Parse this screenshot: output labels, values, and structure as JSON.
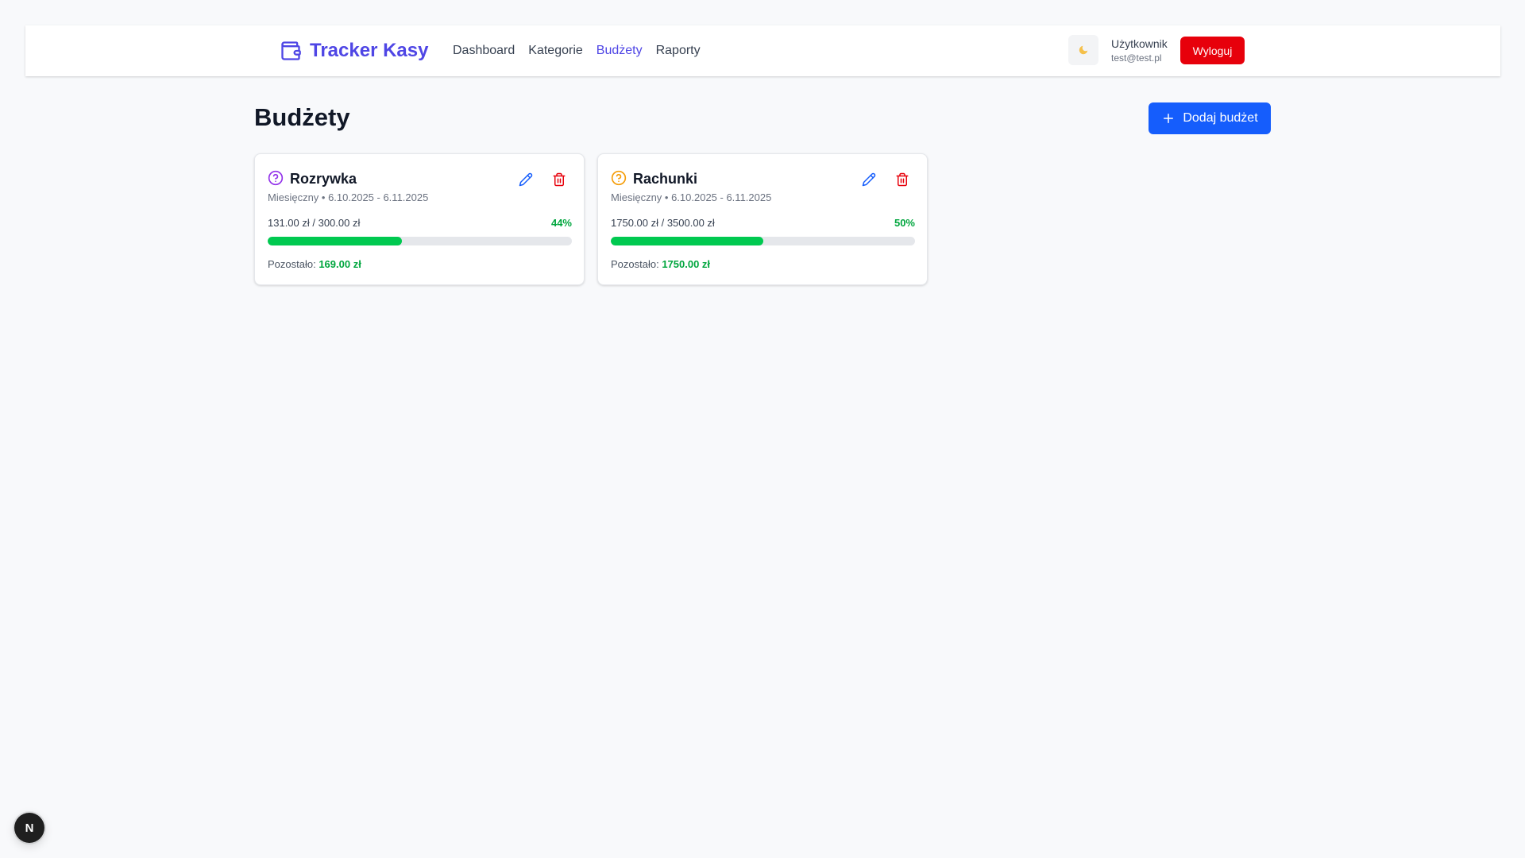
{
  "app": {
    "brand": "Tracker Kasy",
    "brand_color": "#4f46e5"
  },
  "nav": {
    "links": [
      {
        "label": "Dashboard",
        "active": false
      },
      {
        "label": "Kategorie",
        "active": false
      },
      {
        "label": "Budżety",
        "active": true
      },
      {
        "label": "Raporty",
        "active": false
      }
    ]
  },
  "header": {
    "theme_icon": "moon-icon",
    "user_name": "Użytkownik",
    "user_email": "test@test.pl",
    "logout_label": "Wyloguj",
    "logout_color": "#e7000b"
  },
  "main": {
    "title": "Budżety",
    "add_button_label": "Dodaj budżet",
    "add_button_color": "#155dfc"
  },
  "budgets": [
    {
      "name": "Rozrywka",
      "icon": "question-circle-icon",
      "icon_color": "#9333ea",
      "meta": "Miesięczny • 6.10.2025 - 6.11.2025",
      "amounts": "131.00 zł / 300.00 zł",
      "percent_label": "44%",
      "progress_fraction": 0.44,
      "remaining_label": "Pozostało:",
      "remaining_value": "169.00 zł"
    },
    {
      "name": "Rachunki",
      "icon": "question-circle-icon",
      "icon_color": "#f59e0b",
      "meta": "Miesięczny • 6.10.2025 - 6.11.2025",
      "amounts": "1750.00 zł / 3500.00 zł",
      "percent_label": "50%",
      "progress_fraction": 0.5,
      "remaining_label": "Pozostało:",
      "remaining_value": "1750.00 zł"
    }
  ],
  "dev_badge": {
    "label": "N"
  },
  "colors": {
    "progress_fill": "#00c950",
    "progress_track": "#e5e7eb",
    "positive_text": "#00a63e",
    "edit_icon": "#155dfc",
    "delete_icon": "#e7000b"
  }
}
